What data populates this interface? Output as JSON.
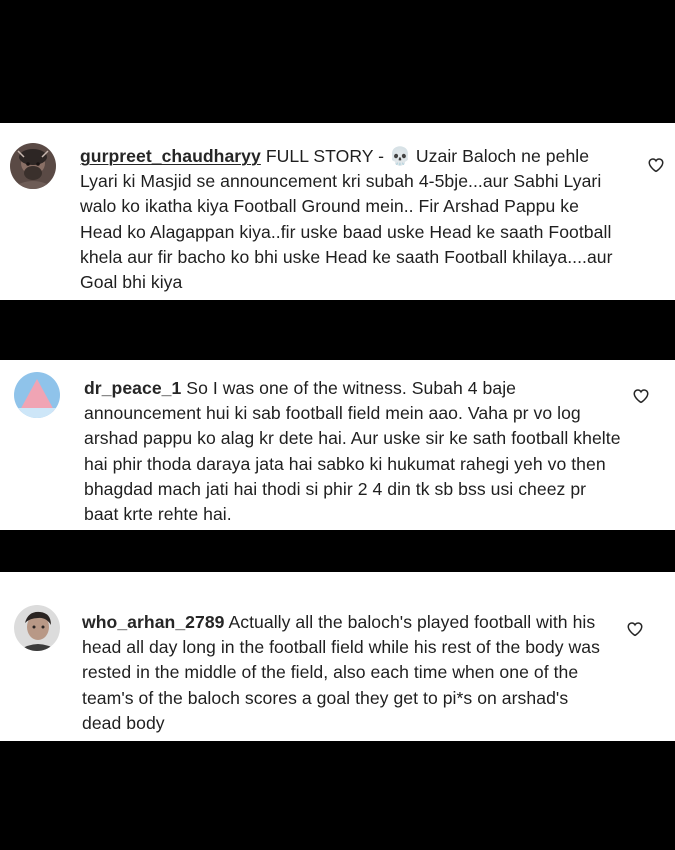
{
  "comments": [
    {
      "username": "gurpreet_chaudharyy",
      "text": "FULL STORY - 💀 Uzair Baloch ne pehle Lyari ki Masjid se announcement kri subah 4-5bje...aur Sabhi Lyari walo ko ikatha kiya Football Ground mein.. Fir Arshad Pappu ke Head ko Alagappan kiya..fir uske baad uske Head ke saath Football khela aur fir bacho ko bhi uske Head ke saath Football khilaya....aur Goal bhi kiya",
      "avatar_icon": "dark-bearded-profile-avatar",
      "like_icon": "heart-outline-icon"
    },
    {
      "username": "dr_peace_1",
      "text": "So I was one of the witness. Subah 4 baje announcement hui ki sab football field mein aao. Vaha pr vo log arshad pappu ko alag kr dete hai. Aur uske sir ke sath football khelte hai phir thoda daraya jata hai sabko ki hukumat rahegi yeh vo then bhagdad mach jati hai thodi si phir 2 4 din tk sb bss usi cheez pr baat krte rehte hai.",
      "avatar_icon": "pink-triangle-blue-sky-avatar",
      "like_icon": "heart-outline-icon"
    },
    {
      "username": "who_arhan_2789",
      "text": "Actually all the baloch's played football with his head all day long in the football field while his rest of the body was rested in the middle of the field, also each time when one of the team's of the baloch scores a goal they get to pi*s on arshad's dead body",
      "avatar_icon": "young-man-profile-avatar",
      "like_icon": "heart-outline-icon"
    }
  ],
  "colors": {
    "background": "#000000",
    "card": "#ffffff",
    "text": "#1f1f1f",
    "username": "#262626"
  }
}
